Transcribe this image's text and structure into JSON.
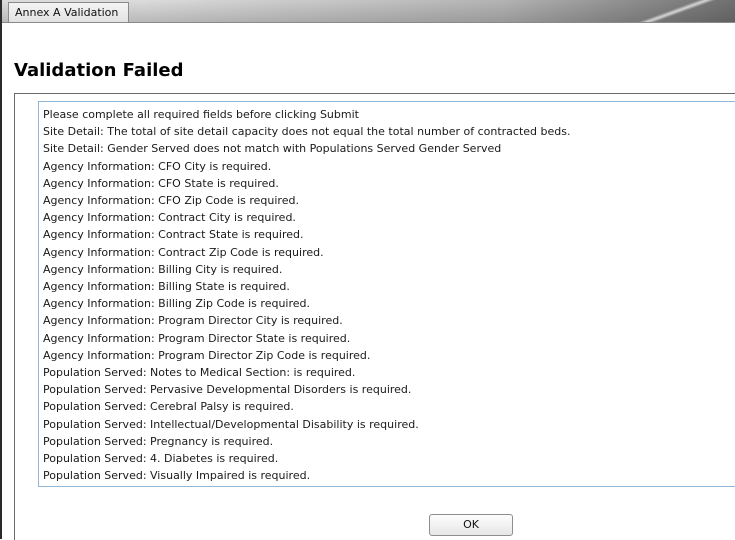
{
  "window": {
    "title": "Annex A Validation"
  },
  "heading": "Validation Failed",
  "messages": [
    "Please complete all required fields before clicking Submit",
    "Site Detail: The total of site detail capacity does not equal the total number of contracted beds.",
    "Site Detail: Gender Served does not match with Populations Served Gender Served",
    "Agency Information: CFO City is required.",
    "Agency Information: CFO State is required.",
    "Agency Information: CFO Zip Code is required.",
    "Agency Information: Contract City is required.",
    "Agency Information: Contract State is required.",
    "Agency Information: Contract Zip Code is required.",
    "Agency Information: Billing City is required.",
    "Agency Information: Billing State is required.",
    "Agency Information: Billing Zip Code is required.",
    "Agency Information: Program Director City is required.",
    "Agency Information: Program Director State is required.",
    "Agency Information: Program Director Zip Code is required.",
    "Population Served: Notes to Medical Section: is required.",
    "Population Served: Pervasive Developmental Disorders is required.",
    "Population Served: Cerebral Palsy is required.",
    "Population Served: Intellectual/Developmental Disability is required.",
    "Population Served: Pregnancy is required.",
    "Population Served: 4. Diabetes is required.",
    "Population Served: Visually Impaired is required."
  ],
  "buttons": {
    "ok": "OK"
  }
}
